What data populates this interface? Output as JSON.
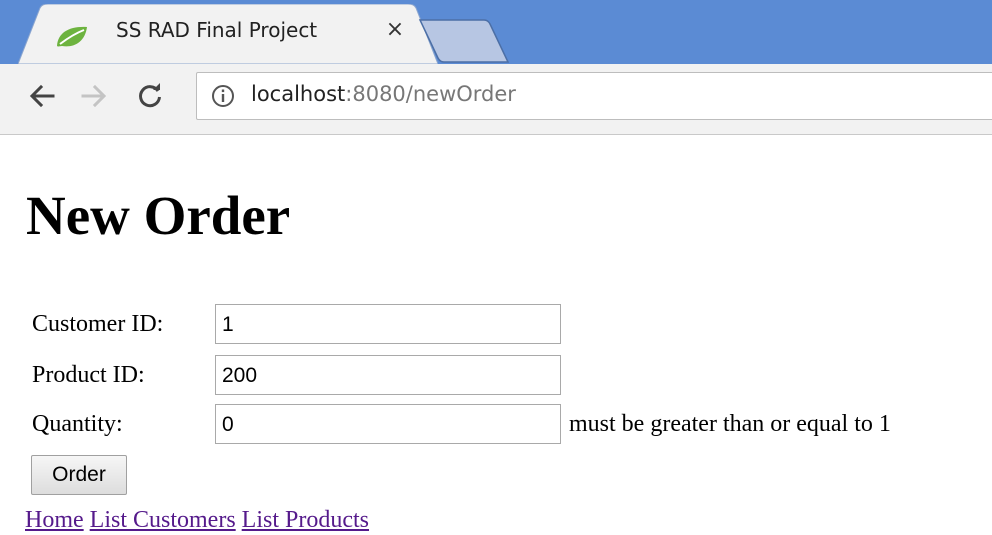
{
  "browser": {
    "tab_title": "SS RAD Final Project",
    "close_glyph": "×",
    "url_host": "localhost",
    "url_rest": ":8080/newOrder",
    "icons": {
      "favicon": "spring-leaf-icon",
      "back": "back-arrow-icon",
      "forward": "forward-arrow-icon",
      "reload": "reload-icon",
      "info": "info-icon"
    },
    "colors": {
      "tabbar": "#5b8bd4",
      "favicon": "#6db33f"
    }
  },
  "page": {
    "heading": "New Order",
    "fields": [
      {
        "label": "Customer ID:",
        "value": "1"
      },
      {
        "label": "Product ID:",
        "value": "200"
      },
      {
        "label": "Quantity:",
        "value": "0",
        "error": "must be greater than or equal to 1"
      }
    ],
    "submit_label": "Order",
    "links": [
      {
        "label": "Home"
      },
      {
        "label": "List Customers"
      },
      {
        "label": "List Products"
      }
    ],
    "link_color": "#551a8b"
  }
}
